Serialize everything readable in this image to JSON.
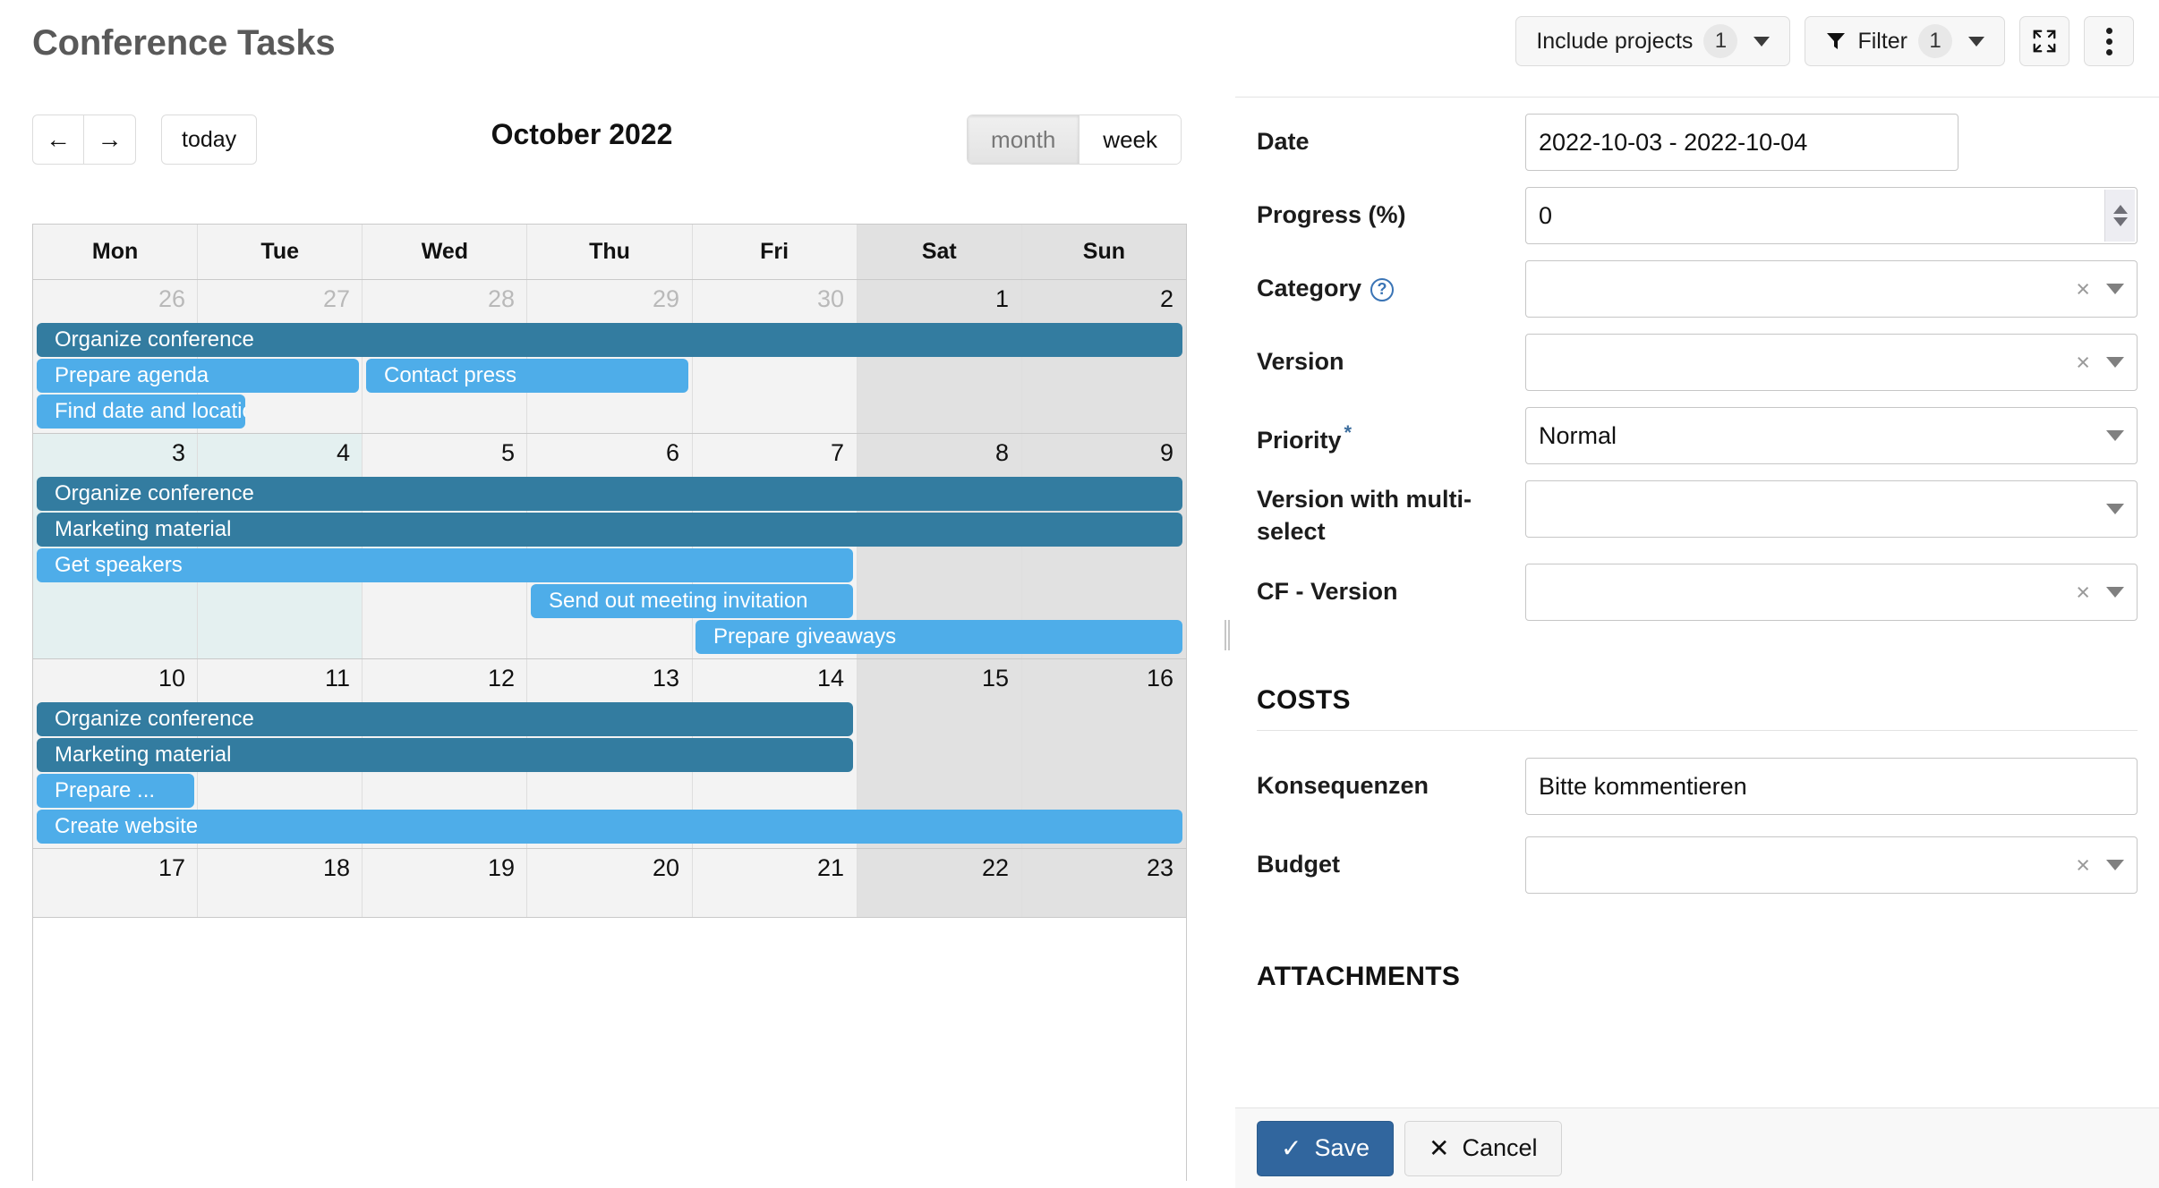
{
  "header": {
    "title": "Conference Tasks",
    "toolbar": {
      "include_projects_label": "Include projects",
      "include_projects_count": "1",
      "filter_label": "Filter",
      "filter_count": "1",
      "fullscreen_icon": "expand-icon",
      "more_icon": "kebab-menu-icon",
      "funnel_icon": "funnel-icon"
    }
  },
  "calendar": {
    "prev_label": "←",
    "next_label": "→",
    "today_label": "today",
    "title": "October 2022",
    "views": [
      {
        "label": "month",
        "active": true
      },
      {
        "label": "week",
        "active": false
      }
    ],
    "day_headers": [
      "Mon",
      "Tue",
      "Wed",
      "Thu",
      "Fri",
      "Sat",
      "Sun"
    ],
    "weeks": [
      {
        "days": [
          {
            "num": "26",
            "other_month": true,
            "weekend": false,
            "highlight": false
          },
          {
            "num": "27",
            "other_month": true,
            "weekend": false,
            "highlight": false
          },
          {
            "num": "28",
            "other_month": true,
            "weekend": false,
            "highlight": false
          },
          {
            "num": "29",
            "other_month": true,
            "weekend": false,
            "highlight": false
          },
          {
            "num": "30",
            "other_month": true,
            "weekend": false,
            "highlight": false
          },
          {
            "num": "1",
            "other_month": false,
            "weekend": true,
            "highlight": false
          },
          {
            "num": "2",
            "other_month": false,
            "weekend": true,
            "highlight": false
          }
        ],
        "events": [
          {
            "label": "Organize conference",
            "start": 0,
            "span": 7,
            "row": 0,
            "style": "dark"
          },
          {
            "label": "Prepare agenda",
            "start": 0,
            "span": 2,
            "row": 1,
            "style": "light"
          },
          {
            "label": "Contact press",
            "start": 2,
            "span": 2,
            "row": 1,
            "style": "light"
          },
          {
            "label": "Find date and location",
            "start": 0,
            "span": 1.31,
            "row": 2,
            "style": "light"
          }
        ]
      },
      {
        "days": [
          {
            "num": "3",
            "other_month": false,
            "weekend": false,
            "highlight": true
          },
          {
            "num": "4",
            "other_month": false,
            "weekend": false,
            "highlight": true
          },
          {
            "num": "5",
            "other_month": false,
            "weekend": false,
            "highlight": false
          },
          {
            "num": "6",
            "other_month": false,
            "weekend": false,
            "highlight": false
          },
          {
            "num": "7",
            "other_month": false,
            "weekend": false,
            "highlight": false
          },
          {
            "num": "8",
            "other_month": false,
            "weekend": true,
            "highlight": false
          },
          {
            "num": "9",
            "other_month": false,
            "weekend": true,
            "highlight": false
          }
        ],
        "events": [
          {
            "label": "Organize conference",
            "start": 0,
            "span": 7,
            "row": 0,
            "style": "dark"
          },
          {
            "label": "Marketing material",
            "start": 0,
            "span": 7,
            "row": 1,
            "style": "dark"
          },
          {
            "label": "Get speakers",
            "start": 0,
            "span": 5,
            "row": 2,
            "style": "light"
          },
          {
            "label": "Send out meeting invitation",
            "start": 3,
            "span": 2,
            "row": 3,
            "style": "light"
          },
          {
            "label": "Prepare giveaways",
            "start": 4,
            "span": 3,
            "row": 4,
            "style": "light"
          }
        ]
      },
      {
        "days": [
          {
            "num": "10",
            "other_month": false,
            "weekend": false,
            "highlight": false
          },
          {
            "num": "11",
            "other_month": false,
            "weekend": false,
            "highlight": false
          },
          {
            "num": "12",
            "other_month": false,
            "weekend": false,
            "highlight": false
          },
          {
            "num": "13",
            "other_month": false,
            "weekend": false,
            "highlight": false
          },
          {
            "num": "14",
            "other_month": false,
            "weekend": false,
            "highlight": false
          },
          {
            "num": "15",
            "other_month": false,
            "weekend": true,
            "highlight": false
          },
          {
            "num": "16",
            "other_month": false,
            "weekend": true,
            "highlight": false
          }
        ],
        "events": [
          {
            "label": "Organize conference",
            "start": 0,
            "span": 5,
            "row": 0,
            "style": "dark"
          },
          {
            "label": "Marketing material",
            "start": 0,
            "span": 5,
            "row": 1,
            "style": "dark"
          },
          {
            "label": "Prepare ...",
            "start": 0,
            "span": 1,
            "row": 2,
            "style": "light"
          },
          {
            "label": "Create website",
            "start": 0,
            "span": 7,
            "row": 3,
            "style": "light"
          }
        ]
      },
      {
        "days": [
          {
            "num": "17",
            "other_month": false,
            "weekend": false,
            "highlight": false
          },
          {
            "num": "18",
            "other_month": false,
            "weekend": false,
            "highlight": false
          },
          {
            "num": "19",
            "other_month": false,
            "weekend": false,
            "highlight": false
          },
          {
            "num": "20",
            "other_month": false,
            "weekend": false,
            "highlight": false
          },
          {
            "num": "21",
            "other_month": false,
            "weekend": false,
            "highlight": false
          },
          {
            "num": "22",
            "other_month": false,
            "weekend": true,
            "highlight": false
          },
          {
            "num": "23",
            "other_month": false,
            "weekend": true,
            "highlight": false
          }
        ],
        "events": []
      }
    ]
  },
  "form": {
    "fields": {
      "date": {
        "label": "Date",
        "value": "2022-10-03 - 2022-10-04"
      },
      "progress": {
        "label": "Progress (%)",
        "value": "0"
      },
      "category": {
        "label": "Category",
        "value": "",
        "help_icon": "question-mark-icon"
      },
      "version": {
        "label": "Version",
        "value": ""
      },
      "priority": {
        "label": "Priority",
        "value": "Normal",
        "required_mark": "*"
      },
      "version_multi": {
        "label": "Version with multi-select",
        "value": ""
      },
      "cf_version": {
        "label": "CF - Version",
        "value": ""
      },
      "konsequenzen": {
        "label": "Konsequenzen",
        "value": "Bitte kommentieren"
      },
      "budget": {
        "label": "Budget",
        "value": ""
      }
    },
    "sections": {
      "costs": "COSTS",
      "attachments": "ATTACHMENTS"
    },
    "clear_glyph": "×",
    "footer": {
      "save_label": "Save",
      "save_icon": "check-icon",
      "cancel_label": "Cancel",
      "cancel_icon": "close-icon"
    }
  },
  "colors": {
    "event_dark": "#337ca0",
    "event_light": "#4eade9",
    "today_highlight": "#e4f0f0",
    "weekend": "#e1e1e1",
    "save_button": "#31669e"
  }
}
